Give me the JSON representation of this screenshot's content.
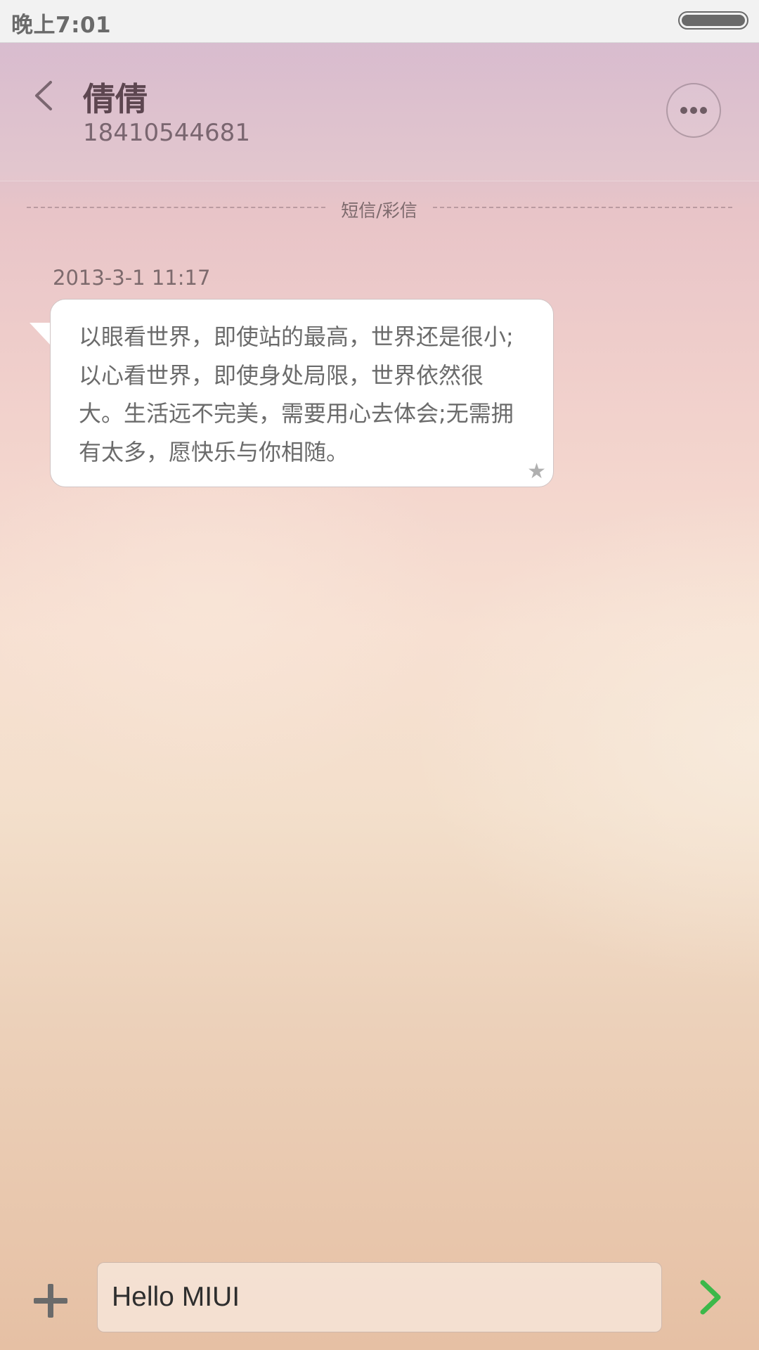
{
  "status_bar": {
    "time": "晚上7:01"
  },
  "header": {
    "contact_name": "倩倩",
    "contact_number": "18410544681",
    "back_icon": "chevron-left-icon",
    "more_icon": "more-dots-icon"
  },
  "conversation": {
    "divider_label": "短信/彩信",
    "messages": [
      {
        "time": "2013-3-1 11:17",
        "text": "以眼看世界，即使站的最高，世界还是很小;以心看世界，即使身处局限，世界依然很大。生活远不完美，需要用心去体会;无需拥有太多，愿快乐与你相随。",
        "starred": true,
        "star_icon": "star-icon"
      }
    ]
  },
  "composer": {
    "add_icon": "plus-icon",
    "input_value": "Hello MIUI",
    "send_icon": "send-chevron-icon",
    "send_color": "#3cb84a"
  }
}
